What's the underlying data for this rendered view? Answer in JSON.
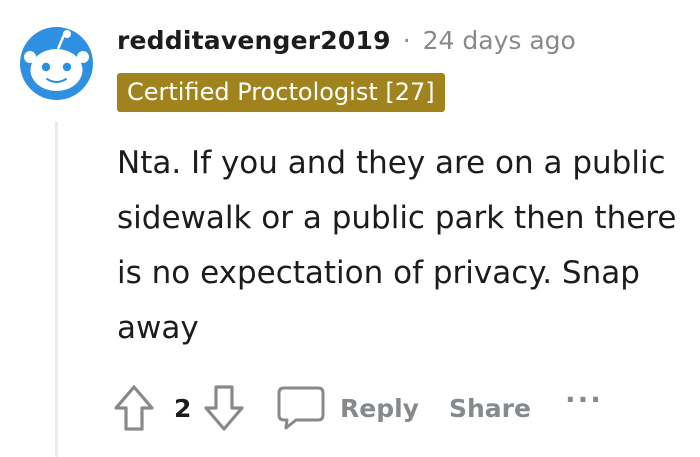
{
  "comment": {
    "username": "redditavenger2019",
    "separator": "·",
    "timestamp": "24 days ago",
    "flair": "Certified Proctologist [27]",
    "body": "Nta. If you and they are on a public sidewalk or a public park then there is no expectation of privacy. Snap away",
    "vote_count": "2",
    "reply_label": "Reply",
    "share_label": "Share",
    "more_label": "···"
  },
  "colors": {
    "flair_background": "#a1831d",
    "flair_text": "#ffffff",
    "muted_text": "#878a8c",
    "avatar_blue": "#2f8fe0",
    "thread_line": "#ececec"
  },
  "icons": {
    "avatar": "reddit-snoo-avatar-icon",
    "upvote": "arrow-up-icon",
    "downvote": "arrow-down-icon",
    "reply": "speech-bubble-icon",
    "more": "ellipsis-icon"
  }
}
